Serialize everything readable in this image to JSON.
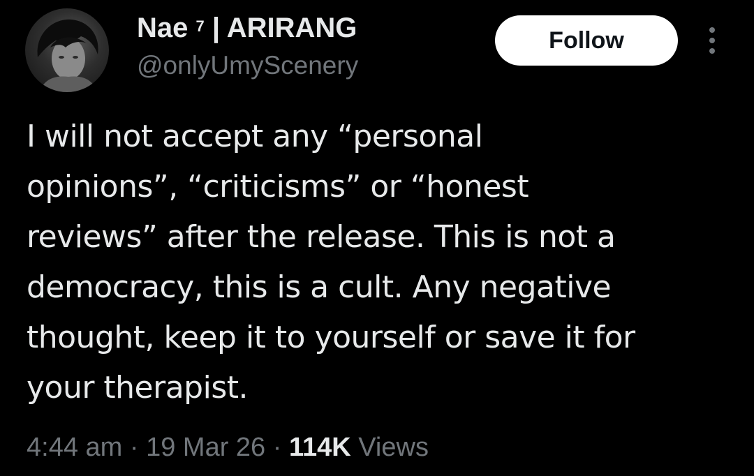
{
  "author": {
    "display_name": "Nae",
    "superscript": "7",
    "name_suffix": " | ARIRANG",
    "handle": "@onlyUmyScenery",
    "avatar_icon": "profile-photo"
  },
  "actions": {
    "follow_label": "Follow",
    "more_icon": "more-vertical-icon"
  },
  "tweet": {
    "text": "I will not accept any “personal\nopinions”, “criticisms” or “honest\nreviews” after the release. This is not a\ndemocracy, this is a cult. Any negative\nthought, keep it to yourself or save it for\nyour therapist."
  },
  "meta": {
    "time": "4:44 am",
    "separator": " · ",
    "date": "19 Mar 26",
    "views_count": "114K",
    "views_label": " Views"
  },
  "colors": {
    "background": "#000000",
    "primary_text": "#e7e9ea",
    "secondary_text": "#71767b",
    "follow_bg": "#ffffff"
  }
}
